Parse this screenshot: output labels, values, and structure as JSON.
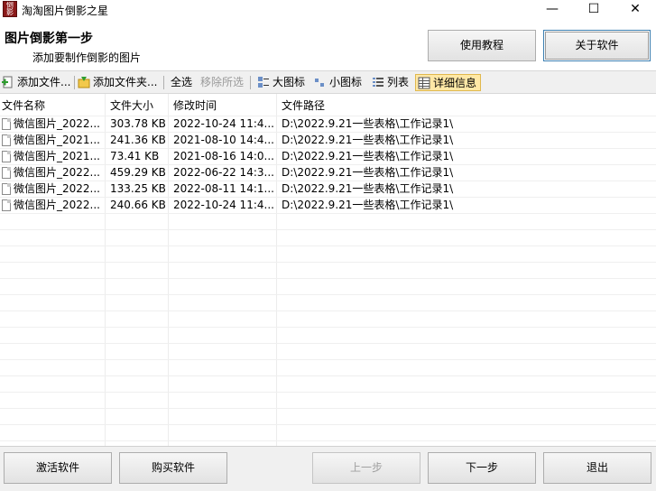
{
  "window": {
    "title": "淘淘图片倒影之星",
    "icon_text": "倒影",
    "minimize_glyph": "—",
    "maximize_glyph": "☐",
    "close_glyph": "✕"
  },
  "header": {
    "step_title": "图片倒影第一步",
    "step_subtitle": "添加要制作倒影的图片",
    "tutorial_button": "使用教程",
    "about_button": "关于软件"
  },
  "toolbar": {
    "add_file": "添加文件...",
    "add_folder": "添加文件夹...",
    "select_all": "全选",
    "remove_selected": "移除所选",
    "large_icons": "大图标",
    "small_icons": "小图标",
    "list": "列表",
    "details": "详细信息"
  },
  "table": {
    "headers": [
      "文件名称",
      "文件大小",
      "修改时间",
      "文件路径"
    ],
    "rows": [
      {
        "name": "微信图片_2022...",
        "size": "303.78 KB",
        "modified": "2022-10-24 11:4...",
        "path": "D:\\2022.9.21一些表格\\工作记录1\\"
      },
      {
        "name": "微信图片_2021...",
        "size": "241.36 KB",
        "modified": "2021-08-10 14:4...",
        "path": "D:\\2022.9.21一些表格\\工作记录1\\"
      },
      {
        "name": "微信图片_2021...",
        "size": "73.41 KB",
        "modified": "2021-08-16 14:0...",
        "path": "D:\\2022.9.21一些表格\\工作记录1\\"
      },
      {
        "name": "微信图片_2022...",
        "size": "459.29 KB",
        "modified": "2022-06-22 14:3...",
        "path": "D:\\2022.9.21一些表格\\工作记录1\\"
      },
      {
        "name": "微信图片_2022...",
        "size": "133.25 KB",
        "modified": "2022-08-11 14:1...",
        "path": "D:\\2022.9.21一些表格\\工作记录1\\"
      },
      {
        "name": "微信图片_2022...",
        "size": "240.66 KB",
        "modified": "2022-10-24 11:4...",
        "path": "D:\\2022.9.21一些表格\\工作记录1\\"
      }
    ]
  },
  "footer": {
    "activate": "激活软件",
    "buy": "购买软件",
    "prev": "上一步",
    "next": "下一步",
    "exit": "退出"
  }
}
